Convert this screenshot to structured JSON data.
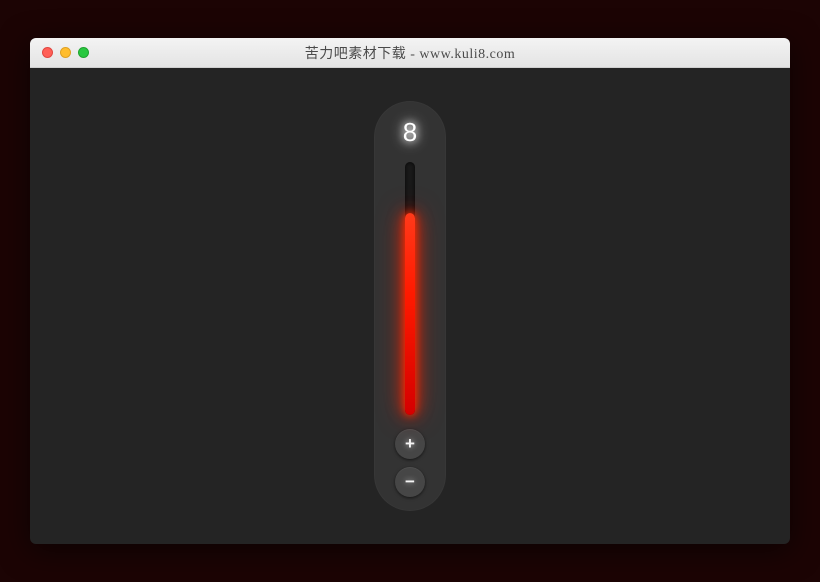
{
  "window": {
    "title": "苦力吧素材下载 - www.kuli8.com"
  },
  "slider": {
    "value": "8",
    "min": 0,
    "max": 10,
    "fill_percent": 80,
    "increment_label": "+",
    "decrement_label": "−",
    "fill_color": "#ff1a00"
  }
}
